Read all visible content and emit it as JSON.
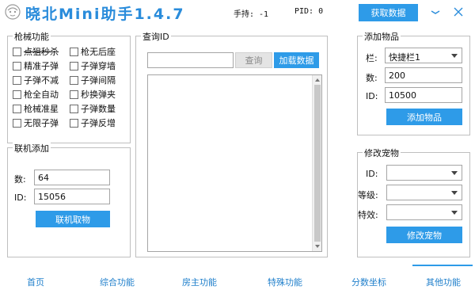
{
  "app": {
    "title": "晓北Mini助手1.4.7",
    "handle_label": "手持: -1",
    "pid_label": "PID: 0",
    "get_data_button": "获取数据"
  },
  "weapons": {
    "group_title": "枪械功能",
    "items": [
      {
        "label": "点狙秒杀",
        "checked": false
      },
      {
        "label": "枪无后座",
        "checked": false
      },
      {
        "label": "精准子弹",
        "checked": false
      },
      {
        "label": "子弹穿墙",
        "checked": false
      },
      {
        "label": "子弹不减",
        "checked": false
      },
      {
        "label": "子弹间隔",
        "checked": false
      },
      {
        "label": "枪全自动",
        "checked": false
      },
      {
        "label": "秒换弹夹",
        "checked": false
      },
      {
        "label": "枪械准星",
        "checked": false
      },
      {
        "label": "子弹数量",
        "checked": false
      },
      {
        "label": "无限子弹",
        "checked": false
      },
      {
        "label": "子弹反增",
        "checked": false
      }
    ]
  },
  "online_add": {
    "group_title": "联机添加",
    "count_label": "数:",
    "count_value": "64",
    "id_label": "ID:",
    "id_value": "15056",
    "button": "联机取物"
  },
  "query": {
    "group_title": "查询ID",
    "input_value": "",
    "query_button": "查询",
    "load_button": "加载数据"
  },
  "add_item": {
    "group_title": "添加物品",
    "slot_label": "栏:",
    "slot_value": "快捷栏1",
    "count_label": "数:",
    "count_value": "200",
    "id_label": "ID:",
    "id_value": "10500",
    "button": "添加物品"
  },
  "pet": {
    "group_title": "修改宠物",
    "id_label": "ID:",
    "id_value": "",
    "level_label": "等级:",
    "level_value": "",
    "effect_label": "特效:",
    "effect_value": "",
    "button": "修改宠物"
  },
  "tabs": [
    {
      "label": "首页"
    },
    {
      "label": "综合功能"
    },
    {
      "label": "房主功能"
    },
    {
      "label": "特殊功能"
    },
    {
      "label": "分数坐标"
    },
    {
      "label": "其他功能"
    }
  ],
  "colors": {
    "accent": "#2e9be8",
    "title": "#2a8cdb",
    "tab_text": "#1f7fcb"
  }
}
